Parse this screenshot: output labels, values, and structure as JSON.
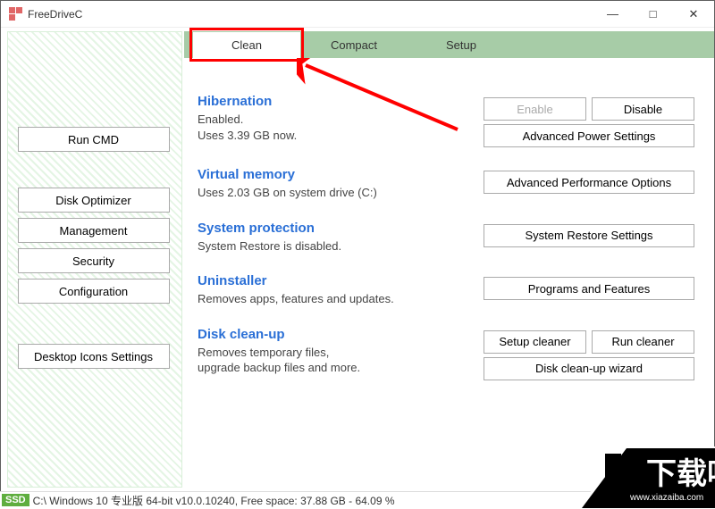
{
  "app": {
    "title": "FreeDriveC"
  },
  "window_controls": {
    "min": "—",
    "max": "□",
    "close": "✕"
  },
  "sidebar": {
    "run_cmd": "Run CMD",
    "disk_optimizer": "Disk Optimizer",
    "management": "Management",
    "security": "Security",
    "configuration": "Configuration",
    "desktop_icons": "Desktop Icons Settings"
  },
  "tabs": {
    "clean": "Clean",
    "compact": "Compact",
    "setup": "Setup"
  },
  "sections": {
    "hibernation": {
      "title": "Hibernation",
      "line1": "Enabled.",
      "line2": "Uses 3.39 GB now.",
      "enable": "Enable",
      "disable": "Disable",
      "adv": "Advanced Power Settings"
    },
    "vm": {
      "title": "Virtual memory",
      "text": "Uses 2.03 GB on system drive (C:)",
      "adv": "Advanced Performance Options"
    },
    "sp": {
      "title": "System protection",
      "text": "System Restore is disabled.",
      "btn": "System Restore Settings"
    },
    "un": {
      "title": "Uninstaller",
      "text": "Removes apps, features and updates.",
      "btn": "Programs and Features"
    },
    "dc": {
      "title": "Disk clean-up",
      "line1": "Removes temporary files,",
      "line2": "upgrade backup files and more.",
      "setup": "Setup cleaner",
      "run": "Run cleaner",
      "wizard": "Disk clean-up wizard"
    }
  },
  "status": {
    "ssd": "SSD",
    "text": "C:\\ Windows 10 专业版 64-bit v10.0.10240, Free space: 37.88 GB - 64.09 %"
  },
  "watermark": {
    "url_text": "www.xiazaiba.com"
  }
}
